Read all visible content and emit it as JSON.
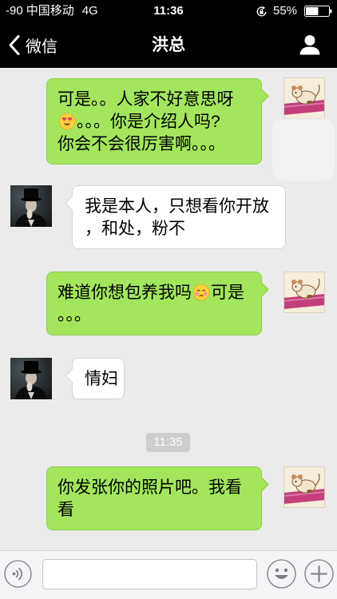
{
  "status_bar": {
    "signal": "-90",
    "carrier": "中国移动",
    "network": "4G",
    "time": "11:36",
    "battery_percent": "55%",
    "battery_level": 0.55,
    "rotation_lock_icon": "rotation-lock-icon",
    "battery_icon": "battery-icon"
  },
  "nav": {
    "back_icon": "chevron-left-icon",
    "back_label": "微信",
    "title": "洪总",
    "profile_icon": "person-icon"
  },
  "messages": [
    {
      "outgoing": true,
      "lines": [
        {
          "text": "可是。。人家不好意思呀"
        },
        {
          "emoji": "heart-eyes-emoji",
          "text": "。。。你是介绍人吗?"
        },
        {
          "text": "你会不会很厉害啊。。。"
        }
      ]
    },
    {
      "outgoing": false,
      "lines": [
        {
          "text": "我是本人，只想看你开放"
        },
        {
          "text": "，和处，粉不"
        }
      ]
    },
    {
      "outgoing": true,
      "lines": [
        {
          "text": "难道你想包养我吗",
          "emoji": "blushing-face-emoji",
          "text_after_emoji": "可是"
        },
        {
          "text": "。。。"
        }
      ]
    },
    {
      "outgoing": false,
      "lines": [
        {
          "text": "情妇"
        }
      ]
    },
    {
      "outgoing": true,
      "lines": [
        {
          "text": "你发张你的照片吧。我看"
        },
        {
          "text": "看"
        }
      ]
    }
  ],
  "timestamp": "11:35",
  "input_bar": {
    "value": "",
    "voice_icon": "voice-icon",
    "emoji_icon": "emoji-icon",
    "more_icon": "plus-icon"
  },
  "colors": {
    "bar_background": "#000000",
    "chat_background": "#ebebeb",
    "outgoing_bubble": "#a3e65c",
    "incoming_bubble": "#ffffff"
  }
}
